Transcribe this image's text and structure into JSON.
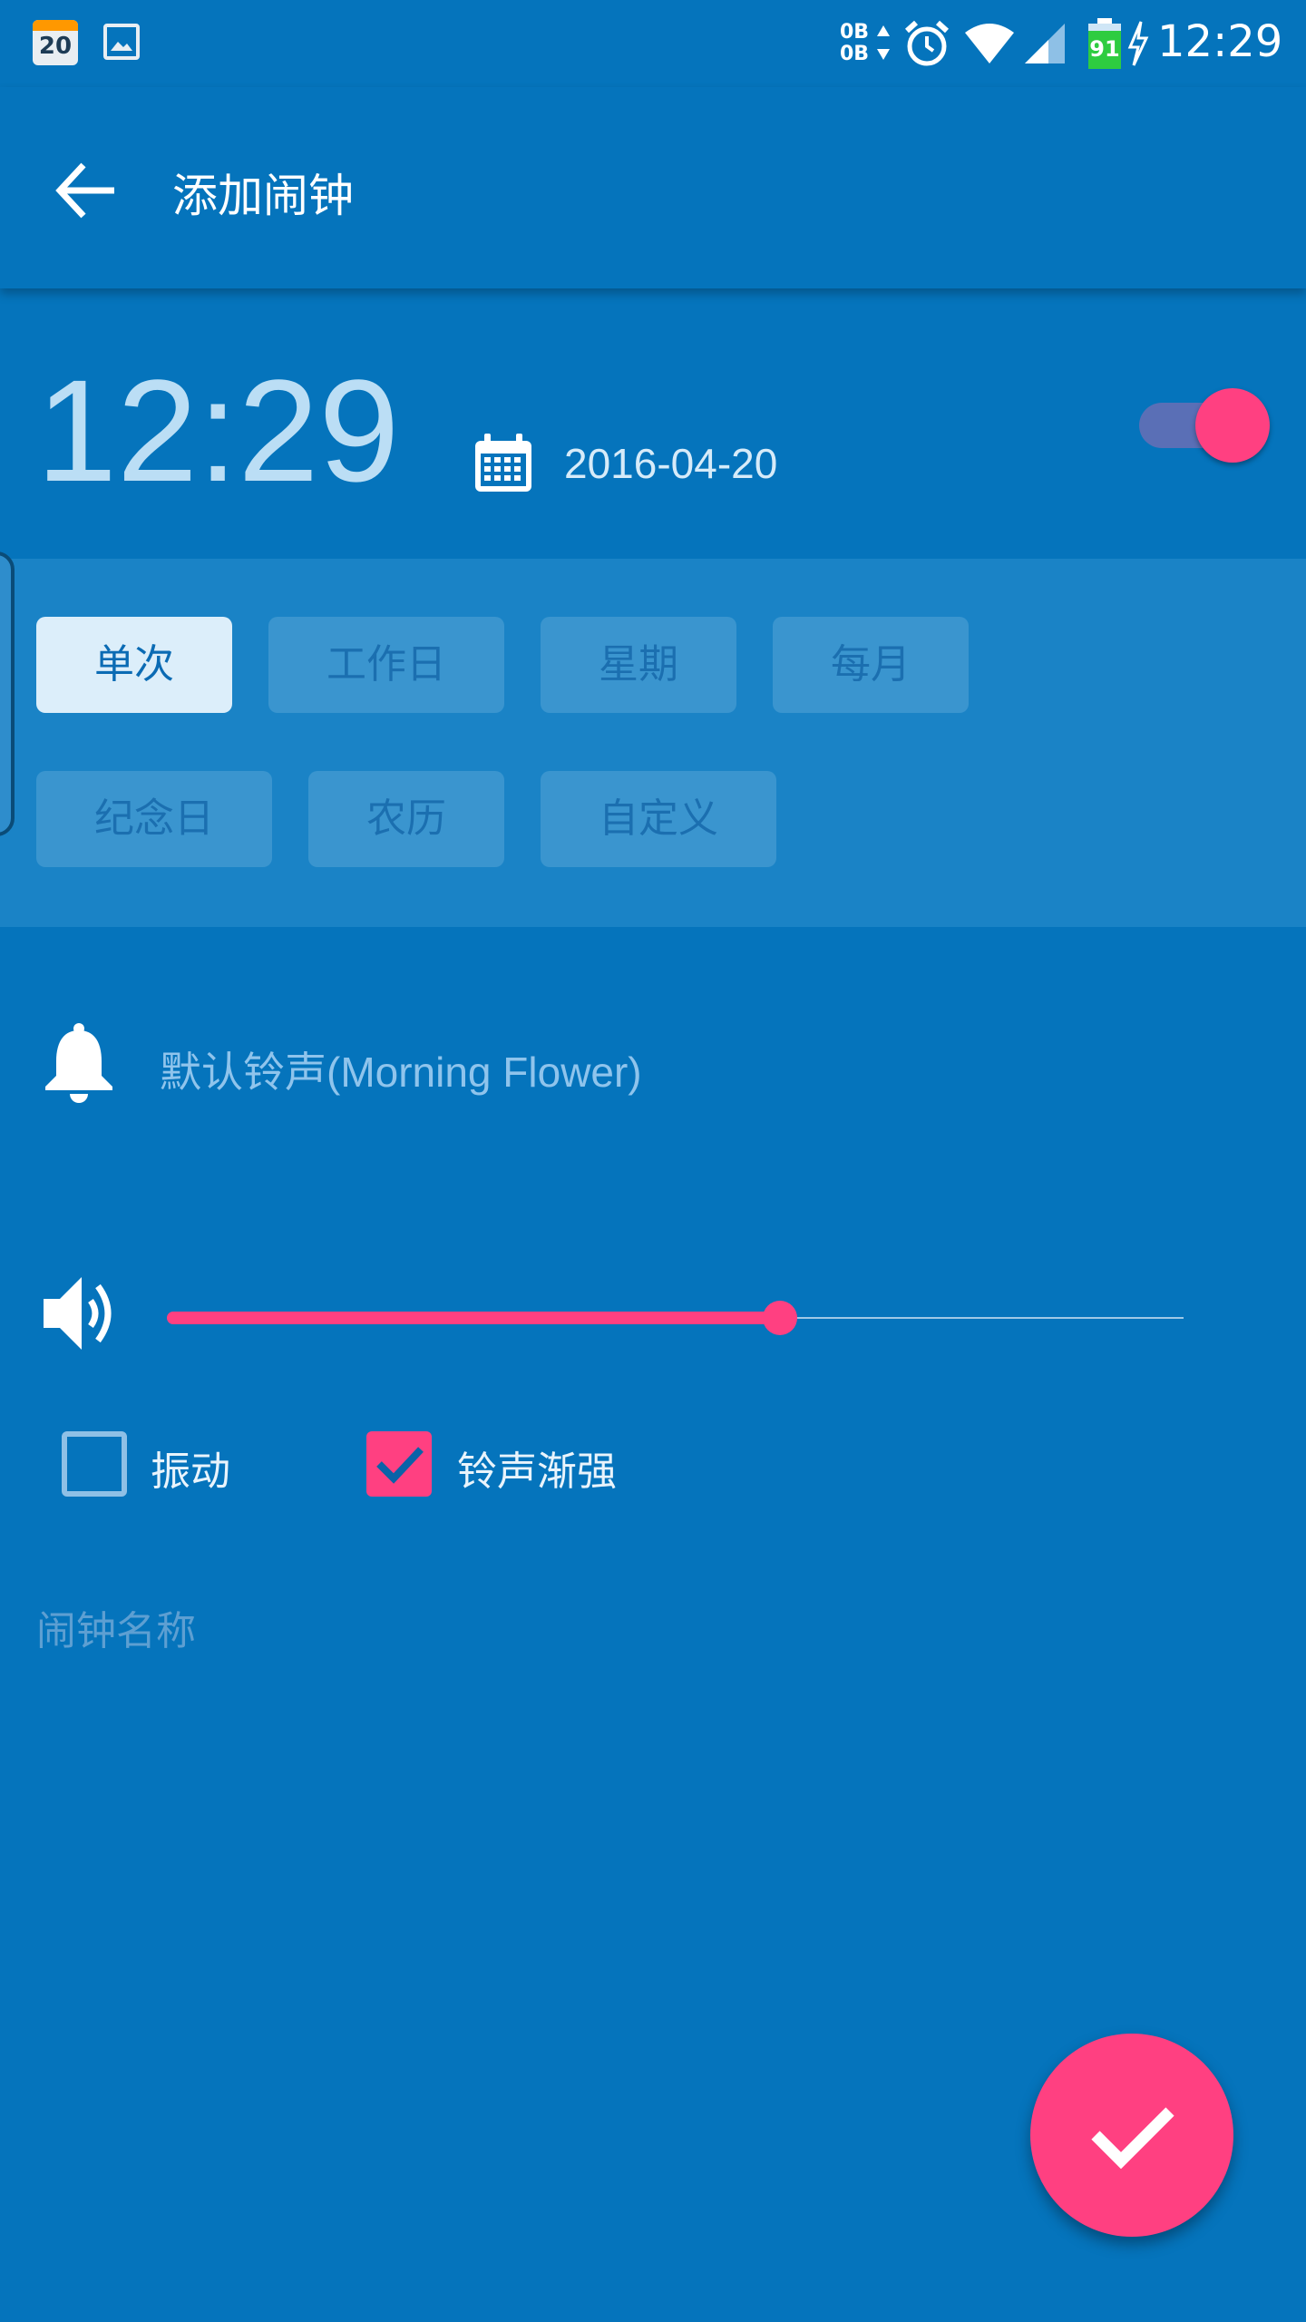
{
  "status_bar": {
    "calendar_day": "20",
    "data_up": "0B",
    "data_down": "0B",
    "battery_level": "91",
    "time": "12:29",
    "icons": [
      "calendar-icon",
      "image-icon",
      "data-traffic-icon",
      "alarm-icon",
      "wifi-icon",
      "signal-icon",
      "battery-icon",
      "charging-icon"
    ]
  },
  "app_bar": {
    "title": "添加闹钟"
  },
  "alarm": {
    "time": "12:29",
    "date": "2016-04-20",
    "enabled": true
  },
  "repeat_options": [
    {
      "label": "单次",
      "selected": true
    },
    {
      "label": "工作日",
      "selected": false
    },
    {
      "label": "星期",
      "selected": false
    },
    {
      "label": "每月",
      "selected": false
    },
    {
      "label": "纪念日",
      "selected": false
    },
    {
      "label": "农历",
      "selected": false
    },
    {
      "label": "自定义",
      "selected": false
    }
  ],
  "ringtone": {
    "label": "默认铃声(Morning Flower)"
  },
  "volume": {
    "level_fraction": 0.6
  },
  "options": {
    "vibrate": {
      "label": "振动",
      "checked": false
    },
    "crescendo": {
      "label": "铃声渐强",
      "checked": true
    }
  },
  "name_field": {
    "placeholder": "闹钟名称"
  },
  "colors": {
    "background": "#0574BC",
    "accent": "#FF4081",
    "panel": "#1A83C6"
  }
}
